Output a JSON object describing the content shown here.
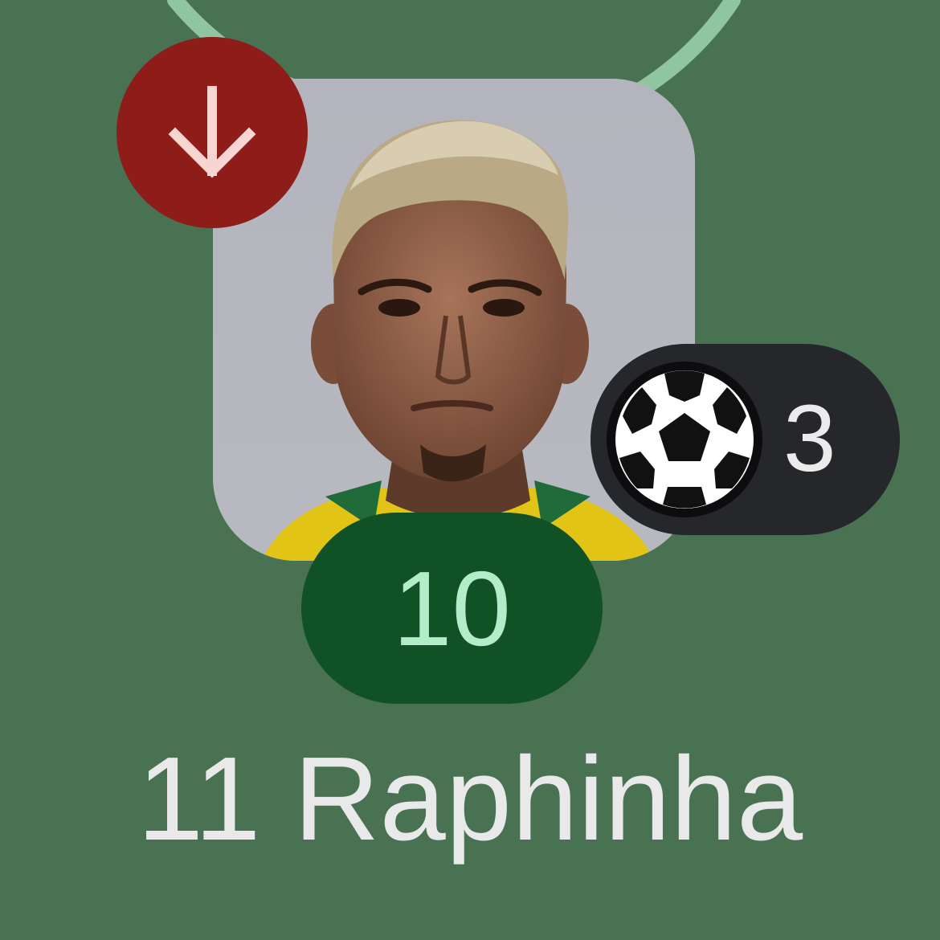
{
  "colors": {
    "pitch_background": "#497253",
    "pitch_line": "#8fc5a1",
    "substitution_badge": "#8e1d1a",
    "goals_pill": "#26272b",
    "rating_pill": "#105125",
    "rating_text": "#b2ecc8"
  },
  "player": {
    "shirt_number": "11",
    "name": "Raphinha",
    "rating": "10",
    "goals": "3",
    "substituted_out": true
  },
  "icons": {
    "substitution": "arrow-down-icon",
    "goals": "soccer-ball-icon"
  }
}
